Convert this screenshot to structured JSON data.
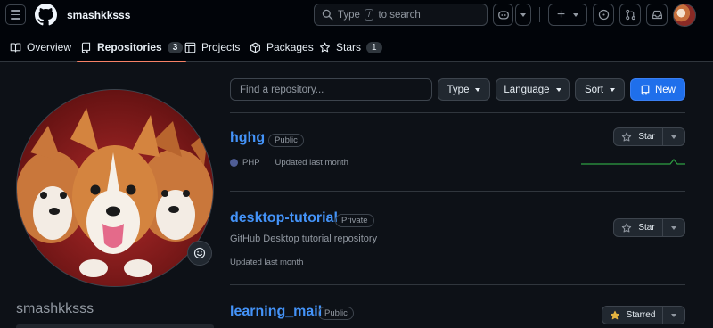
{
  "header": {
    "owner": "smashkksss",
    "search_prefix": "Type",
    "search_key": "/",
    "search_suffix": "to search"
  },
  "tabs": [
    {
      "label": "Overview"
    },
    {
      "label": "Repositories",
      "count": "3"
    },
    {
      "label": "Projects"
    },
    {
      "label": "Packages"
    },
    {
      "label": "Stars",
      "count": "1"
    }
  ],
  "sidebar": {
    "username": "smashkksss"
  },
  "filter": {
    "placeholder": "Find a repository...",
    "type_label": "Type",
    "language_label": "Language",
    "sort_label": "Sort",
    "new_label": "New"
  },
  "repos": [
    {
      "name": "hghg",
      "visibility": "Public",
      "language": "PHP",
      "updated": "Updated last month",
      "star_label": "Star"
    },
    {
      "name": "desktop-tutorial",
      "visibility": "Private",
      "description": "GitHub Desktop tutorial repository",
      "updated": "Updated last month",
      "star_label": "Star"
    },
    {
      "name": "learning_mail",
      "visibility": "Public",
      "star_label": "Starred"
    }
  ],
  "colors": {
    "accent": "#1f6feb",
    "link": "#4493f8",
    "tab_underline": "#f78166",
    "php": "#4f5d95",
    "starred_star": "#e3b341",
    "spark": "#2ea043"
  }
}
